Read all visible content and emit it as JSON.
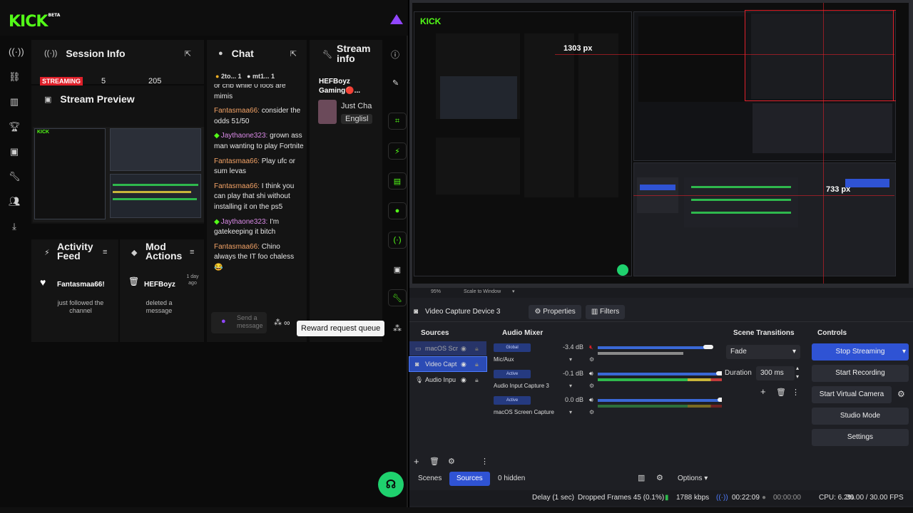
{
  "kick": {
    "logo": "KICK",
    "beta": "BETA",
    "panels": {
      "session_info": "Session Info",
      "chat": "Chat",
      "stream_info": "Stream info",
      "stream_preview": "Stream Preview",
      "activity_feed": "Activity Feed",
      "mod_actions": "Mod Actions"
    },
    "session_stats": {
      "badge": "STREAMING",
      "viewers": "5",
      "followers": "205"
    },
    "chat_header_users": [
      {
        "name": "2to...",
        "count": "1"
      },
      {
        "name": "mt1...",
        "count": "1"
      }
    ],
    "chat_messages": [
      {
        "user": "",
        "text": "or cnb while 0 foos are mimis"
      },
      {
        "user": "Fantasmaa66:",
        "text": "consider the odds 51/50"
      },
      {
        "user": "Jaythaone323:",
        "text": "grown ass man wanting to play Fortnite"
      },
      {
        "user": "Fantasmaa66:",
        "text": "Play ufc or sum levas"
      },
      {
        "user": "Fantasmaa66:",
        "text": "I think you can play that shi without installing it on the ps5"
      },
      {
        "user": "Jaythaone323:",
        "text": "I'm gatekeeping it bitch"
      },
      {
        "user": "Fantasmaa66:",
        "text": "Chino always the IT foo chaless 😂"
      }
    ],
    "chat_input_placeholder": "Send a message",
    "stream_info": {
      "channel": "HEFBoyz Gaming🔴...",
      "title": "Just Cha",
      "language": "Englisl"
    },
    "activity": {
      "user": "Fantasmaa66!",
      "text": "just followed the channel"
    },
    "mod": {
      "user": "HEFBoyz",
      "time": "1 day ago",
      "text": "deleted a message"
    },
    "tooltip": "Reward request queue"
  },
  "obs": {
    "overlay_labels": {
      "width_label": "1303 px",
      "height_label": "733 px"
    },
    "zoom": {
      "value": "95%",
      "mode": "Scale to Window"
    },
    "selected_source": "Video Capture Device 3",
    "properties_label": "Properties",
    "filters_label": "Filters",
    "sources_title": "Sources",
    "sources": [
      {
        "name": "macOS Scr",
        "icon": "display-icon"
      },
      {
        "name": "Video Capt",
        "icon": "camera-icon"
      },
      {
        "name": "Audio Inpu",
        "icon": "mic-icon"
      }
    ],
    "mixer_title": "Audio Mixer",
    "mixer": [
      {
        "pill": "Global",
        "db": "-3.4 dB",
        "name": "Mic/Aux",
        "level": 0.86
      },
      {
        "pill": "Active",
        "db": "-0.1 dB",
        "name": "Audio Input Capture 3",
        "level": 0.96
      },
      {
        "pill": "Active",
        "db": "0.0 dB",
        "name": "macOS Screen Capture",
        "level": 0.97
      }
    ],
    "transitions_title": "Scene Transitions",
    "transition": "Fade",
    "duration_label": "Duration",
    "duration_value": "300 ms",
    "controls_title": "Controls",
    "controls": {
      "stop_streaming": "Stop Streaming",
      "start_recording": "Start Recording",
      "start_virtual_camera": "Start Virtual Camera",
      "studio_mode": "Studio Mode",
      "settings": "Settings"
    },
    "tabs": {
      "scenes": "Scenes",
      "sources": "Sources",
      "hidden": "0 hidden",
      "options": "Options"
    },
    "status": {
      "delay": "Delay (1 sec)",
      "dropped": "Dropped Frames 45 (0.1%)",
      "kbps": "1788 kbps",
      "stream_time": "00:22:09",
      "rec_time": "00:00:00",
      "cpu": "CPU: 6.2%",
      "fps": "30.00 / 30.00 FPS"
    }
  }
}
